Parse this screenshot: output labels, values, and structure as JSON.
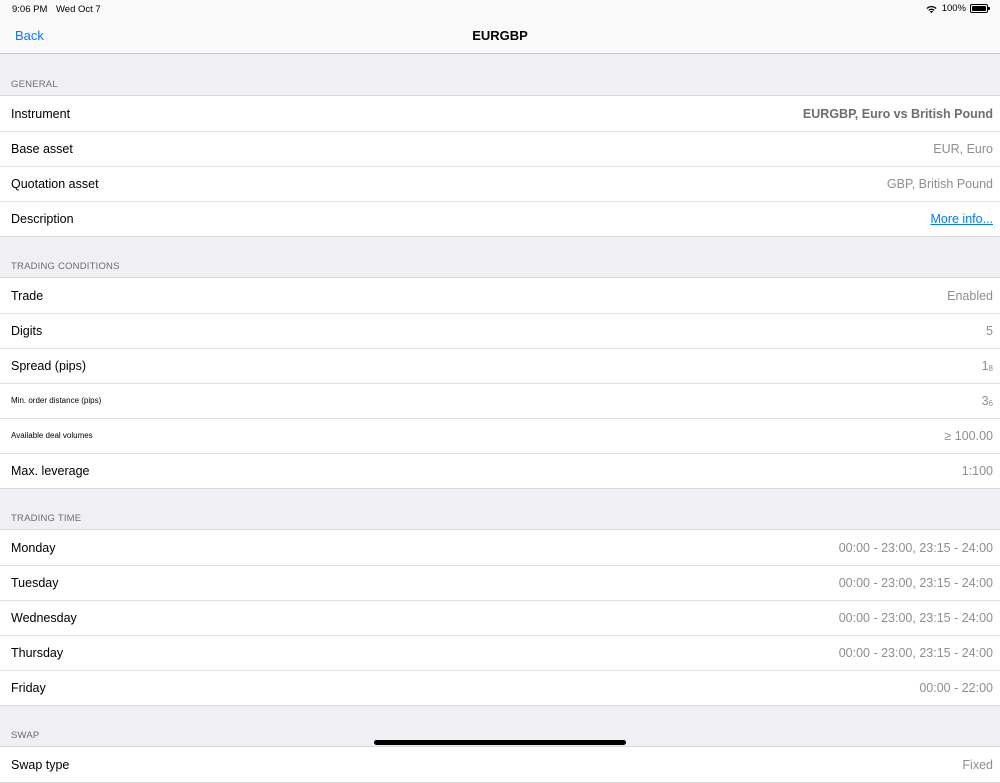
{
  "status": {
    "time": "9:06 PM",
    "date": "Wed Oct 7",
    "battery": "100%"
  },
  "nav": {
    "back": "Back",
    "title": "EURGBP"
  },
  "sections": [
    {
      "header": "GENERAL",
      "rows": [
        {
          "label": "Instrument",
          "value": "EURGBP, Euro vs British Pound",
          "style": "bold"
        },
        {
          "label": "Base asset",
          "value": "EUR, Euro"
        },
        {
          "label": "Quotation asset",
          "value": "GBP, British Pound"
        },
        {
          "label": "Description",
          "value": "More info...",
          "style": "link"
        }
      ]
    },
    {
      "header": "TRADING CONDITIONS",
      "rows": [
        {
          "label": "Trade",
          "value": "Enabled"
        },
        {
          "label": "Digits",
          "value": "5"
        },
        {
          "label": "Spread (pips)",
          "value": "1",
          "sub": "8"
        },
        {
          "label": "Min. order distance (pips)",
          "value": "3",
          "sub": "6",
          "small": true
        },
        {
          "label": "Available deal volumes",
          "value": "≥  100.00",
          "small": true
        },
        {
          "label": "Max. leverage",
          "value": "1:100"
        }
      ]
    },
    {
      "header": "TRADING TIME",
      "rows": [
        {
          "label": "Monday",
          "value": "00:00 - 23:00, 23:15 - 24:00"
        },
        {
          "label": "Tuesday",
          "value": "00:00 - 23:00, 23:15 - 24:00"
        },
        {
          "label": "Wednesday",
          "value": "00:00 - 23:00, 23:15 - 24:00"
        },
        {
          "label": "Thursday",
          "value": "00:00 - 23:00, 23:15 - 24:00"
        },
        {
          "label": "Friday",
          "value": "00:00 - 22:00"
        }
      ]
    },
    {
      "header": "SWAP",
      "rows": [
        {
          "label": "Swap type",
          "value": "Fixed"
        }
      ]
    }
  ]
}
